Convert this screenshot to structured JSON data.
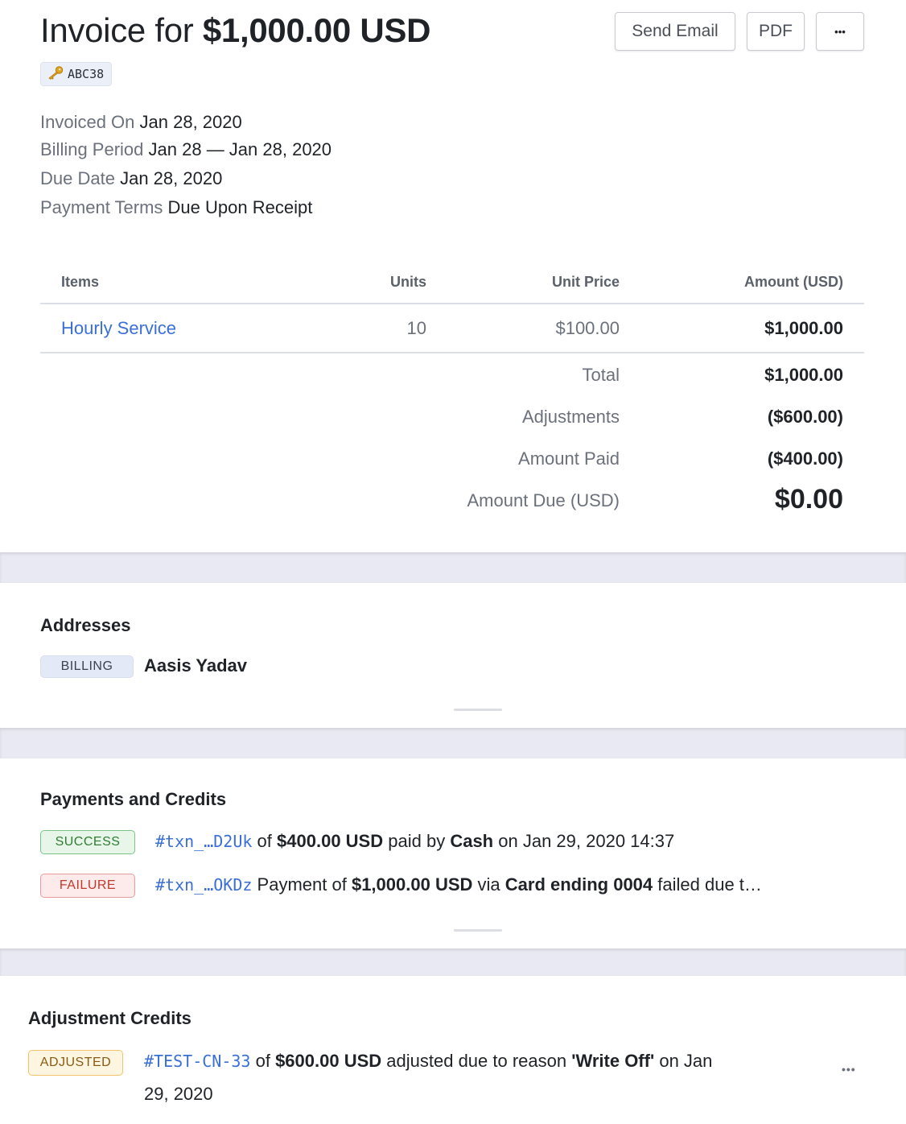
{
  "header": {
    "title_prefix": "Invoice for",
    "title_amount": "$1,000.00 USD",
    "id_badge": "ABC38",
    "buttons": {
      "send_email": "Send Email",
      "pdf": "PDF",
      "more": "•••"
    }
  },
  "meta": [
    {
      "label": "Invoiced On",
      "value": "Jan 28, 2020"
    },
    {
      "label": "Billing Period",
      "value": "Jan 28 — Jan 28, 2020"
    },
    {
      "label": "Due Date",
      "value": "Jan 28, 2020"
    },
    {
      "label": "Payment Terms",
      "value": "Due Upon Receipt"
    }
  ],
  "table": {
    "headers": {
      "items": "Items",
      "units": "Units",
      "unit_price": "Unit Price",
      "amount": "Amount (USD)"
    },
    "rows": [
      {
        "item": "Hourly Service",
        "units": "10",
        "unit_price": "$100.00",
        "amount": "$1,000.00"
      }
    ],
    "summary": {
      "total_label": "Total",
      "total_value": "$1,000.00",
      "adjustments_label": "Adjustments",
      "adjustments_value": "($600.00)",
      "paid_label": "Amount Paid",
      "paid_value": "($400.00)",
      "due_label": "Amount Due (USD)",
      "due_value": "$0.00"
    }
  },
  "addresses": {
    "title": "Addresses",
    "billing_tag": "BILLING",
    "billing_name": "Aasis Yadav"
  },
  "payments": {
    "title": "Payments and Credits",
    "items": [
      {
        "status": "SUCCESS",
        "txn": "#txn_…D2Uk",
        "t1": "of",
        "amount": "$400.00 USD",
        "t2": "paid by",
        "method": "Cash",
        "t3": "on Jan 29, 2020 14:37"
      },
      {
        "status": "FAILURE",
        "txn": "#txn_…OKDz",
        "t1": "Payment of",
        "amount": "$1,000.00 USD",
        "t2": "via",
        "method": "Card ending 0004",
        "t3": "failed due t…"
      }
    ]
  },
  "adjustments": {
    "title": "Adjustment Credits",
    "items": [
      {
        "status": "ADJUSTED",
        "ref": "#TEST-CN-33",
        "t1": "of",
        "amount": "$600.00 USD",
        "t2": "adjusted due to reason",
        "reason": "'Write Off'",
        "t3": "on Jan",
        "t4": "29, 2020"
      }
    ],
    "more": "•••"
  },
  "colors": {
    "link": "#3a6fd8",
    "success": "#2e7d32",
    "failure": "#c0392b",
    "adjusted": "#8a5a12",
    "separator": "#e8e9f2"
  },
  "icons": {
    "id_badge_icon": "key-icon"
  }
}
